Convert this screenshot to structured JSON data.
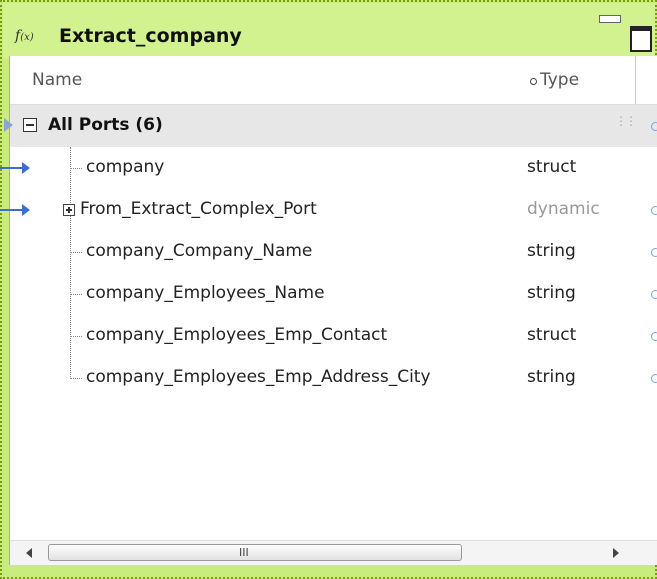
{
  "window": {
    "title": "Extract_company",
    "icon": "function-fx-icon",
    "accent_color": "#c8ed7e"
  },
  "table": {
    "columns": [
      "Name",
      "Type"
    ],
    "group": {
      "label": "All Ports (6)"
    },
    "rows": [
      {
        "name": "company",
        "type": "struct"
      },
      {
        "name": "From_Extract_Complex_Port",
        "type": "dynamic"
      },
      {
        "name": "company_Company_Name",
        "type": "string"
      },
      {
        "name": "company_Employees_Name",
        "type": "string"
      },
      {
        "name": "company_Employees_Emp_Contact",
        "type": "struct"
      },
      {
        "name": "company_Employees_Emp_Address_City",
        "type": "string"
      }
    ]
  },
  "scrollbar": {
    "grip": "III"
  }
}
